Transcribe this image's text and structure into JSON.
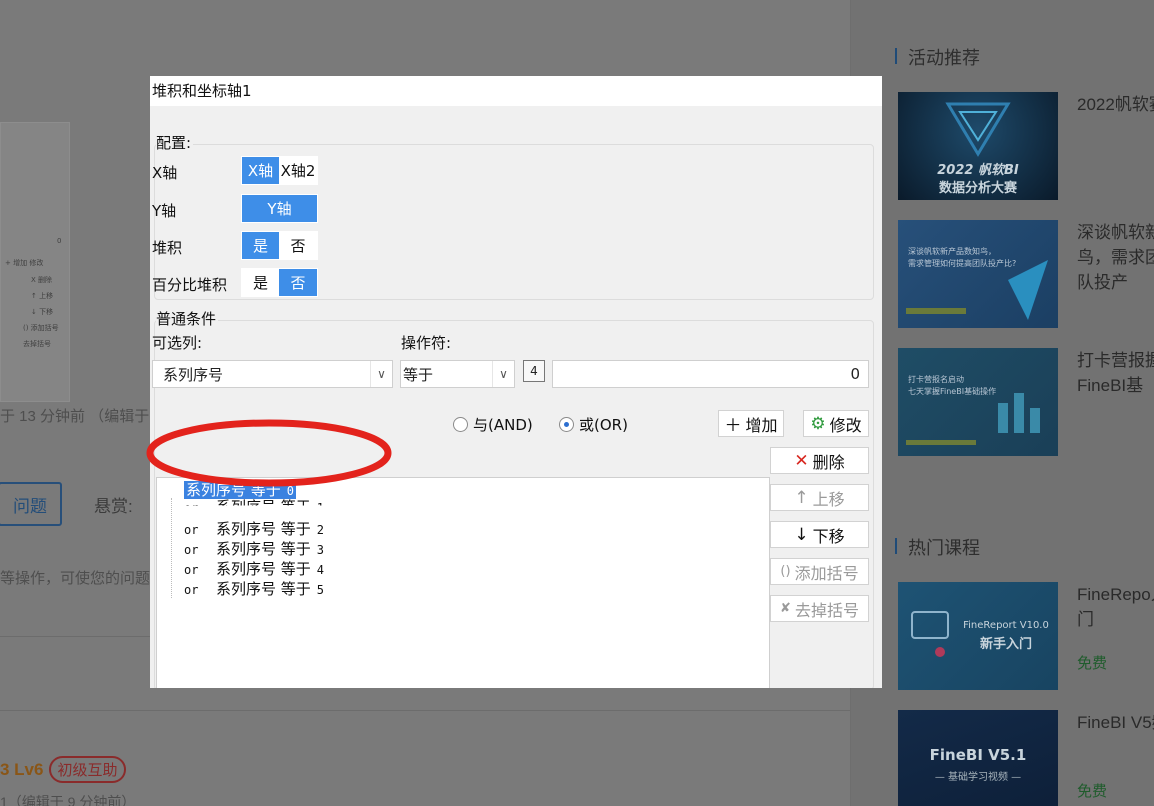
{
  "background": {
    "thumb_rows": [
      "0",
      "+ 增加  修改",
      "X 删除",
      "↑ 上移",
      "↓ 下移",
      "() 添加括号",
      "去掉括号"
    ],
    "edit_time_line": "于 13 分钟前 （编辑于",
    "question_button": "问题",
    "reward_label": "悬赏:",
    "tip_text": "等操作，可使您的问题",
    "level": "3  Lv6",
    "level_badge": "初级互助",
    "edit_time_line2": "1（编辑于 9 分钟前）"
  },
  "sidebar": {
    "activity_title": "活动推荐",
    "hot_courses_title": "热门课程",
    "cards": [
      {
        "text": "2022帆软赛",
        "img_caption": "2022帆软BI数据分析大赛"
      },
      {
        "text": "深谈帆软新鸟，需求团队投产",
        "img_caption": "深谈帆软新产品数知鸟，需求管理如何提高团队投产比?"
      },
      {
        "text": "打卡营报握FineBI基",
        "img_caption": "打卡营报名启动 七天掌握FineBI基础操作"
      }
    ],
    "courses": [
      {
        "text": "FineRepo入门",
        "img_caption": "FineReport V10.0 新手入门",
        "price": "免费"
      },
      {
        "text": "FineBI V5频",
        "img_caption": "FineBI V5.1 — 基础学习视频 —",
        "price": "免费"
      }
    ]
  },
  "dialog": {
    "title": "堆积和坐标轴1",
    "config_legend": "配置:",
    "x_axis_label": "X轴",
    "x_axis_options": [
      "X轴",
      "X轴2"
    ],
    "y_axis_label": "Y轴",
    "y_axis_options": [
      "Y轴"
    ],
    "stack_label": "堆积",
    "stack_options": [
      "是",
      "否"
    ],
    "percent_stack_label": "百分比堆积",
    "percent_stack_options": [
      "是",
      "否"
    ],
    "common_legend": "普通条件",
    "column_label": "可选列:",
    "column_value": "系列序号",
    "operator_label": "操作符:",
    "operator_value": "等于",
    "format_icon": "4",
    "value_input": "0",
    "radio_and": "与(AND)",
    "radio_or": "或(OR)",
    "add_button": "增加",
    "modify_button": "修改",
    "delete_button": "删除",
    "move_up_button": "上移",
    "move_down_button": "下移",
    "add_paren_button": "添加括号",
    "remove_paren_button": "去掉括号",
    "conditions": [
      {
        "op": "",
        "text": "系列序号 等于",
        "val": "0"
      },
      {
        "op": "or",
        "text": "系列序号 等于",
        "val": "1"
      },
      {
        "op": "or",
        "text": "系列序号 等于",
        "val": "2"
      },
      {
        "op": "or",
        "text": "系列序号 等于",
        "val": "3"
      },
      {
        "op": "or",
        "text": "系列序号 等于",
        "val": "4"
      },
      {
        "op": "or",
        "text": "系列序号 等于",
        "val": "5"
      }
    ]
  },
  "annotation": {
    "color": "#e3231c",
    "shape": "ellipse"
  }
}
